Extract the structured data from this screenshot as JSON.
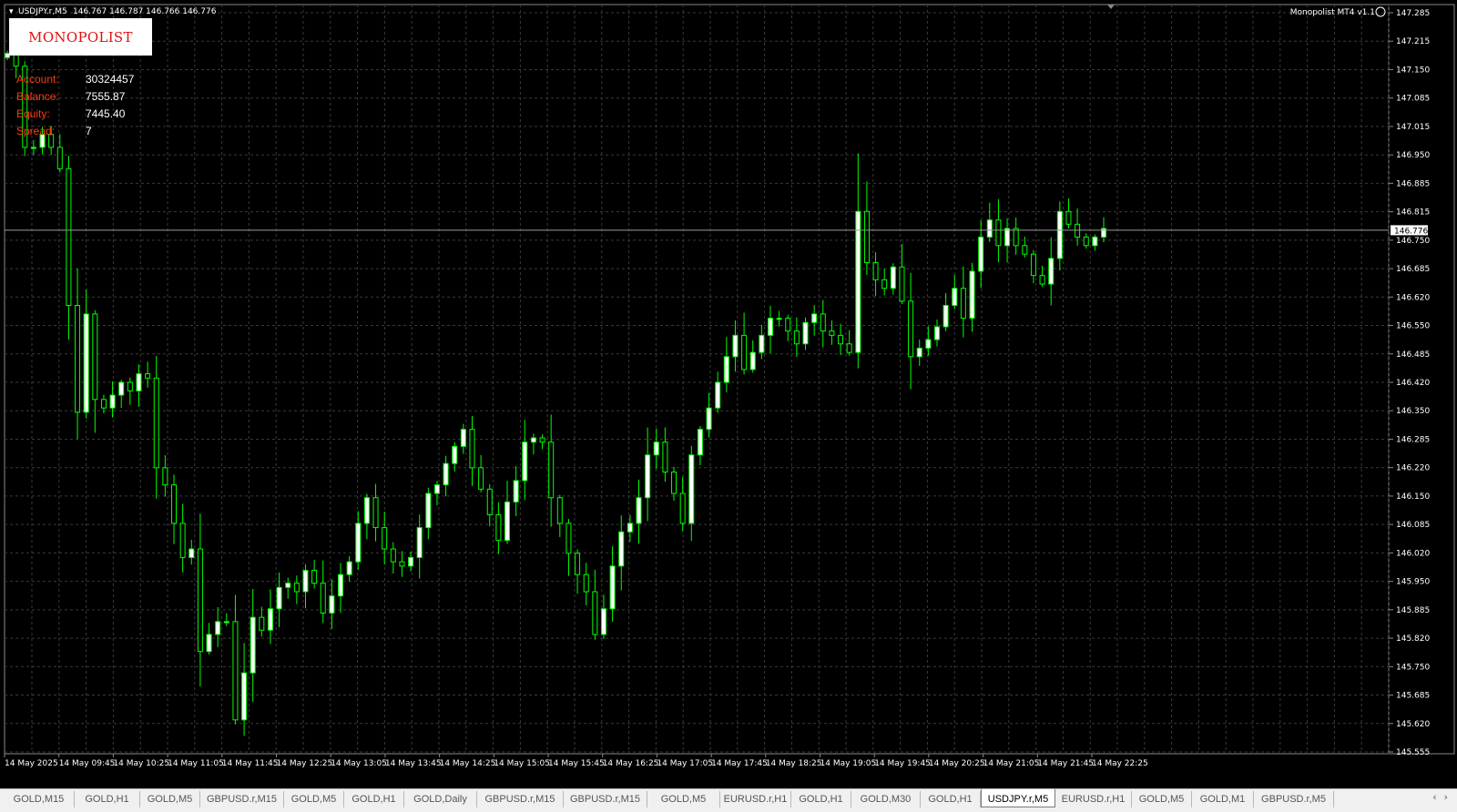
{
  "chart": {
    "header_symbol": "USDJPY.r,M5",
    "header_ohlc": "146.767 146.787 146.766 146.776",
    "ea_label": "Monopolist MT4 v1.1",
    "current_price": "146.776",
    "current_price_value": 146.776
  },
  "logo": {
    "text": "MONOPOLIST"
  },
  "account_info": {
    "account_label": "Account:",
    "account_value": "30324457",
    "balance_label": "Balance:",
    "balance_value": "7555.87",
    "equity_label": "Equity:",
    "equity_value": "7445.40",
    "spread_label": "Spread:",
    "spread_value": "7"
  },
  "colors": {
    "background": "#000000",
    "grid": "#3a3a3a",
    "candle": "#00ff00",
    "bull_fill": "#ffffff",
    "bear_fill": "#000000",
    "label_orange": "#ff3b12",
    "logo_red": "#e01010"
  },
  "chart_data": {
    "type": "candlestick",
    "symbol": "USDJPY.r",
    "timeframe": "M5",
    "y_ticks": [
      "147.285",
      "147.215",
      "147.150",
      "147.085",
      "147.015",
      "146.950",
      "146.885",
      "146.815",
      "146.750",
      "146.685",
      "146.620",
      "146.550",
      "146.485",
      "146.420",
      "146.350",
      "146.285",
      "146.220",
      "146.150",
      "146.085",
      "146.020",
      "145.950",
      "145.885",
      "145.820",
      "145.750",
      "145.685",
      "145.620",
      "145.555"
    ],
    "ylim": [
      145.555,
      147.285
    ],
    "x_ticks": [
      "14 May 2025",
      "14 May 09:45",
      "14 May 10:25",
      "14 May 11:05",
      "14 May 11:45",
      "14 May 12:25",
      "14 May 13:05",
      "14 May 13:45",
      "14 May 14:25",
      "14 May 15:05",
      "14 May 15:45",
      "14 May 16:25",
      "14 May 17:05",
      "14 May 17:45",
      "14 May 18:25",
      "14 May 19:05",
      "14 May 19:45",
      "14 May 20:25",
      "14 May 21:05",
      "14 May 21:45",
      "14 May 22:25"
    ],
    "closes": [
      147.19,
      147.16,
      146.97,
      146.97,
      147.0,
      146.97,
      146.92,
      146.6,
      146.35,
      146.58,
      146.38,
      146.36,
      146.39,
      146.42,
      146.4,
      146.44,
      146.43,
      146.22,
      146.18,
      146.09,
      146.01,
      146.03,
      145.79,
      145.83,
      145.86,
      145.86,
      145.63,
      145.74,
      145.87,
      145.84,
      145.89,
      145.94,
      145.95,
      145.93,
      145.98,
      145.95,
      145.88,
      145.92,
      145.97,
      146.0,
      146.09,
      146.15,
      146.08,
      146.03,
      146.0,
      145.99,
      146.01,
      146.08,
      146.16,
      146.18,
      146.23,
      146.27,
      146.31,
      146.22,
      146.17,
      146.11,
      146.05,
      146.14,
      146.19,
      146.28,
      146.29,
      146.28,
      146.15,
      146.09,
      146.02,
      145.97,
      145.93,
      145.83,
      145.89,
      145.99,
      146.07,
      146.09,
      146.15,
      146.25,
      146.28,
      146.21,
      146.16,
      146.09,
      146.25,
      146.31,
      146.36,
      146.42,
      146.48,
      146.53,
      146.45,
      146.49,
      146.53,
      146.57,
      146.57,
      146.54,
      146.51,
      146.56,
      146.58,
      146.54,
      146.53,
      146.51,
      146.49,
      146.82,
      146.7,
      146.66,
      146.64,
      146.69,
      146.61,
      146.48,
      146.5,
      146.52,
      146.55,
      146.6,
      146.64,
      146.57,
      146.68,
      146.76,
      146.8,
      146.74,
      146.78,
      146.74,
      146.72,
      146.67,
      146.65,
      146.71,
      146.82,
      146.79,
      146.76,
      146.74,
      146.76,
      146.78
    ]
  },
  "tabs": [
    {
      "label": "GOLD,M15",
      "active": false
    },
    {
      "label": "GOLD,H1",
      "active": false
    },
    {
      "label": "GOLD,M5",
      "active": false
    },
    {
      "label": "GBPUSD.r,M15",
      "active": false
    },
    {
      "label": "GOLD,M5",
      "active": false
    },
    {
      "label": "GOLD,H1",
      "active": false
    },
    {
      "label": "GOLD,Daily",
      "active": false
    },
    {
      "label": "GBPUSD.r,M15",
      "active": false
    },
    {
      "label": "GBPUSD.r,M15",
      "active": false
    },
    {
      "label": "GOLD,M5",
      "active": false
    },
    {
      "label": "EURUSD.r,H1",
      "active": false
    },
    {
      "label": "GOLD,H1",
      "active": false
    },
    {
      "label": "GOLD,M30",
      "active": false
    },
    {
      "label": "GOLD,H1",
      "active": false
    },
    {
      "label": "USDJPY.r,M5",
      "active": true
    },
    {
      "label": "EURUSD.r,H1",
      "active": false
    },
    {
      "label": "GOLD,M5",
      "active": false
    },
    {
      "label": "GOLD,M1",
      "active": false
    },
    {
      "label": "GBPUSD.r,M5",
      "active": false
    }
  ],
  "tab_nav": {
    "prev": "‹",
    "next": "›"
  }
}
